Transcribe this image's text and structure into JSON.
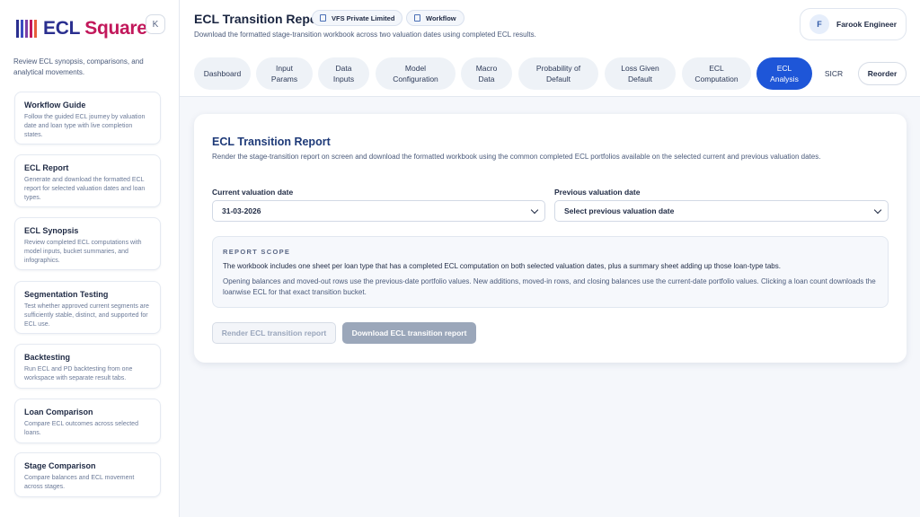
{
  "sidebar": {
    "brand": "ECL",
    "brand_accent": "Square",
    "collapse_label": "K",
    "description": "Review ECL synopsis, comparisons, and analytical movements.",
    "items": [
      {
        "title": "Workflow Guide",
        "desc": "Follow the guided ECL journey by valuation date and loan type with live completion states."
      },
      {
        "title": "ECL Report",
        "desc": "Generate and download the formatted ECL report for selected valuation dates and loan types."
      },
      {
        "title": "ECL Synopsis",
        "desc": "Review completed ECL computations with model inputs, bucket summaries, and infographics."
      },
      {
        "title": "Segmentation Testing",
        "desc": "Test whether approved current segments are sufficiently stable, distinct, and supported for ECL use."
      },
      {
        "title": "Backtesting",
        "desc": "Run ECL and PD backtesting from one workspace with separate result tabs."
      },
      {
        "title": "Loan Comparison",
        "desc": "Compare ECL outcomes across selected loans."
      },
      {
        "title": "Stage Comparison",
        "desc": "Compare balances and ECL movement across stages."
      }
    ]
  },
  "header": {
    "title": "ECL Transition Report",
    "chip_company": "VFS Private Limited",
    "chip_workflow": "Workflow",
    "subtitle": "Download the formatted stage-transition workbook across two valuation dates using completed ECL results.",
    "user_initial": "F",
    "user_name": "Farook Engineer"
  },
  "tabs": [
    {
      "label": "Dashboard",
      "active": false
    },
    {
      "label": "Input Params",
      "active": false
    },
    {
      "label": "Data Inputs",
      "active": false
    },
    {
      "label": "Model Configuration",
      "active": false
    },
    {
      "label": "Macro Data",
      "active": false
    },
    {
      "label": "Probability of Default",
      "active": false
    },
    {
      "label": "Loss Given Default",
      "active": false
    },
    {
      "label": "ECL Computation",
      "active": false
    },
    {
      "label": "ECL Analysis",
      "active": true
    },
    {
      "label": "SICR",
      "active": false
    }
  ],
  "reorder_label": "Reorder",
  "main": {
    "title": "ECL Transition Report",
    "description": "Render the stage-transition report on screen and download the formatted workbook using the common completed ECL portfolios available on the selected current and previous valuation dates.",
    "current_label": "Current valuation date",
    "current_value": "31-03-2026",
    "previous_label": "Previous valuation date",
    "previous_value": "Select previous valuation date",
    "scope_heading": "REPORT SCOPE",
    "scope_p1": "The workbook includes one sheet per loan type that has a completed ECL computation on both selected valuation dates, plus a summary sheet adding up those loan-type tabs.",
    "scope_p2": "Opening balances and moved-out rows use the previous-date portfolio values. New additions, moved-in rows, and closing balances use the current-date portfolio values. Clicking a loan count downloads the loanwise ECL for that exact transition bucket.",
    "render_label": "Render ECL transition report",
    "download_label": "Download ECL transition report"
  },
  "colors": {
    "accent": "#1e56d8",
    "brand": "#2a2f8f",
    "brand_accent": "#c2185b"
  }
}
